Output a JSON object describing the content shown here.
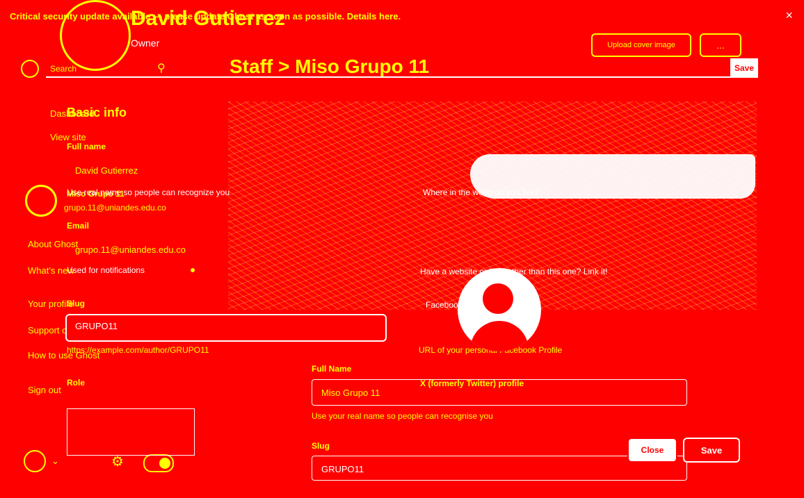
{
  "banner": {
    "text": "Critical security update available — please update Ghost as soon as possible. Details here.",
    "close_icon": "×"
  },
  "staff": {
    "name": "David Gutierrez",
    "role": "Owner",
    "upload_label": "Upload cover image",
    "more_label": "...",
    "breadcrumb": "Staff > Miso Grupo 11",
    "save_label": "Save"
  },
  "sidebar": {
    "search_label": "Search",
    "items": [
      {
        "label": "Dashboard"
      },
      {
        "label": "View site"
      },
      {
        "label": "About Ghost"
      },
      {
        "label": "What's new"
      },
      {
        "label": "Your profile"
      },
      {
        "label": "Support center"
      },
      {
        "label": "How to use Ghost"
      },
      {
        "label": "Sign out"
      }
    ],
    "profile": {
      "name": "Miso Grupo 11",
      "email": "grupo.11@uniandes.edu.co"
    }
  },
  "modal": {
    "section_title": "Basic info",
    "full_name_label": "Full name",
    "full_name_value": "David Gutierrez",
    "full_name_hint": "Use real name so people can recognize you",
    "email_label": "Email",
    "email_value": "grupo.11@uniandes.edu.co",
    "email_hint": "Used for notifications",
    "slug_label": "Slug",
    "slug_value": "GRUPO11",
    "slug_hint": "https://example.com/author/GRUPO11",
    "role_label": "Role",
    "where_live": "Where in the world do you live?",
    "website_hint": "Have a website or blog other than this one? Link it!",
    "facebook_label": "Facebook profile",
    "facebook_hint": "URL of your personal Facebook Profile",
    "x_label": "X (formerly Twitter) profile",
    "right_full_name_label": "Full Name",
    "right_full_name_value": "Miso Grupo 11",
    "right_full_name_hint": "Use your real name so people can recognise you",
    "right_slug_label": "Slug",
    "right_slug_value": "GRUPO11",
    "close_label": "Close",
    "save_label": "Save"
  },
  "colors": {
    "background": "#ff0000",
    "primary_text": "#ffff00",
    "secondary_text": "#ffffff"
  }
}
